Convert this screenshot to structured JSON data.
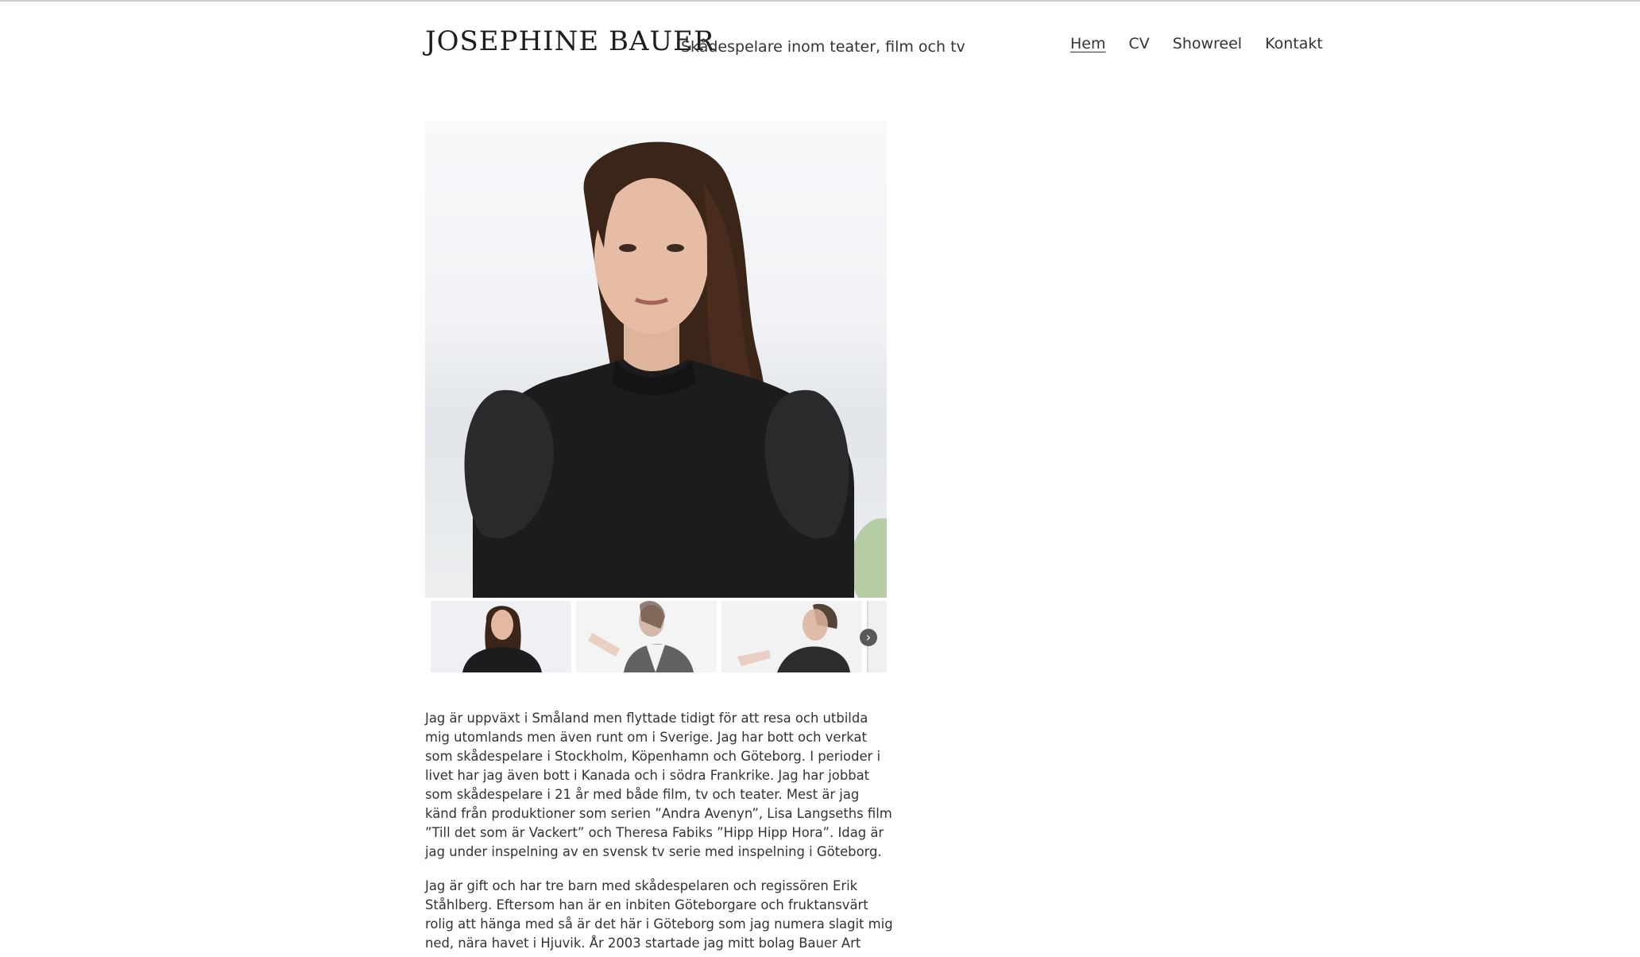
{
  "header": {
    "title": "JOSEPHINE BAUER",
    "tagline": "Skådespelare inom teater, film och tv"
  },
  "nav": {
    "items": [
      {
        "label": "Hem",
        "active": true
      },
      {
        "label": "CV",
        "active": false
      },
      {
        "label": "Showreel",
        "active": false
      },
      {
        "label": "Kontakt",
        "active": false
      }
    ]
  },
  "gallery": {
    "next_icon": "chevron-right-icon",
    "thumbnail_count_visible": 4
  },
  "content": {
    "paragraph_1": "Jag är uppväxt i Småland men flyttade tidigt för att resa och utbilda mig utomlands men även runt om i Sverige. Jag har bott och verkat som skådespelare i Stockholm, Köpenhamn och Göteborg. I perioder i livet har jag även bott i Kanada och i södra Frankrike. Jag har jobbat som skådespelare i 21 år med både film, tv och teater. Mest är jag känd från produktioner som serien ”Andra Avenyn”, Lisa Langseths film ”Till det som är Vackert” och Theresa Fabiks ”Hipp Hipp Hora”. Idag är jag under inspelning av en svensk tv serie med inspelning i Göteborg.",
    "paragraph_2": "Jag är gift och har tre barn med skådespelaren och regissören Erik Ståhlberg. Eftersom han är en inbiten Göteborgare och fruktansvärt rolig att hänga med så är det här i Göteborg som jag numera slagit mig ned, nära havet i Hjuvik. År 2003 startade jag mitt bolag Bauer Art genom"
  },
  "colors": {
    "text": "#333333",
    "background": "#ffffff",
    "rule": "#cfcfcf"
  }
}
